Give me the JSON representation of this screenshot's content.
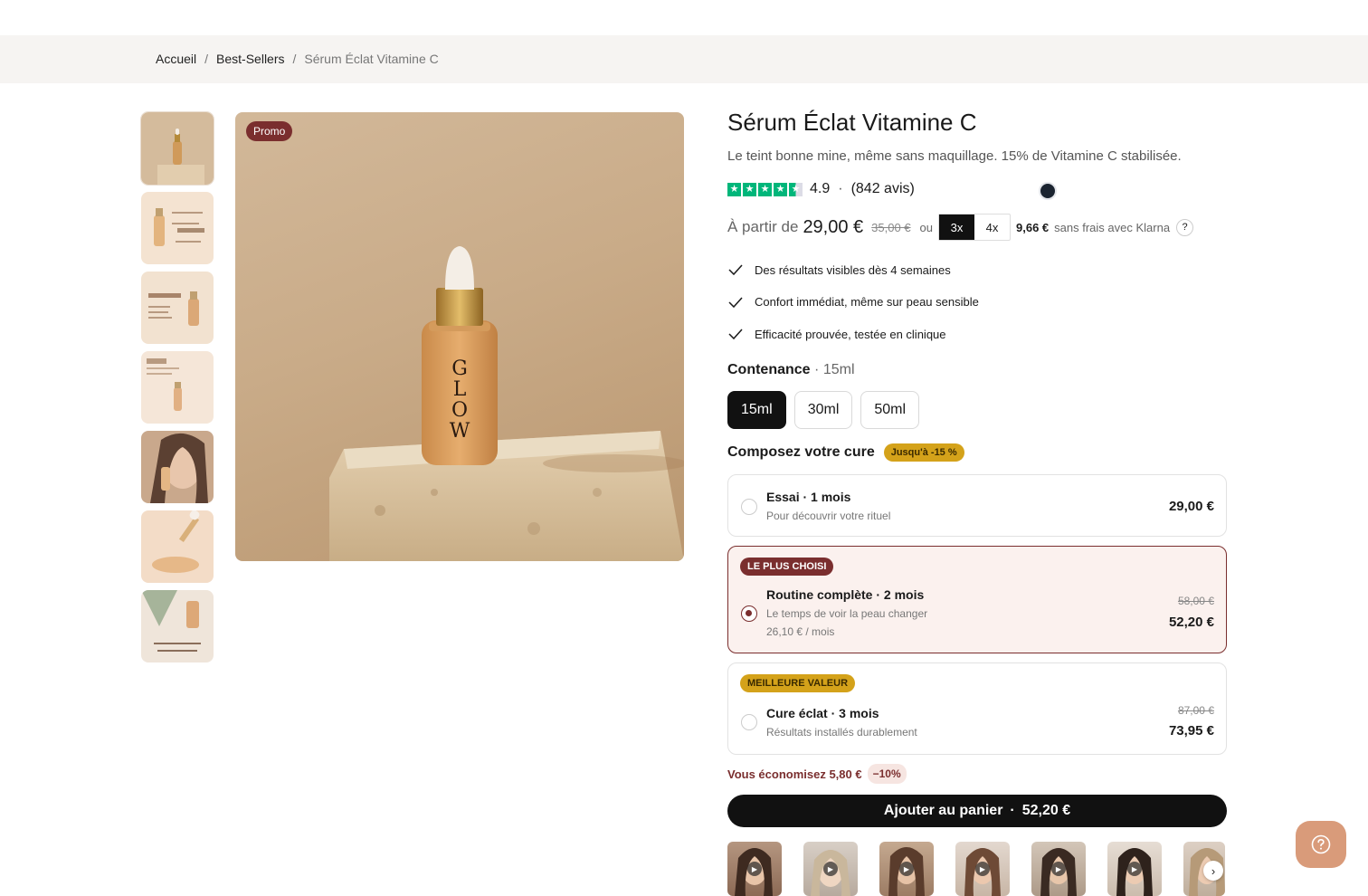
{
  "breadcrumb": {
    "home": "Accueil",
    "category": "Best-Sellers",
    "current": "Sérum Éclat Vitamine C",
    "sep": "/"
  },
  "gallery": {
    "promo_badge": "Promo",
    "bottle_letters": [
      "G",
      "L",
      "O",
      "W"
    ],
    "thumbnails": [
      "product-photo",
      "benefits-card",
      "key-actives-card",
      "stats-card",
      "model-applying",
      "texture-swatch",
      "packaging-card"
    ]
  },
  "product": {
    "title": "Sérum Éclat Vitamine C",
    "subtitle": "Le teint bonne mine, même sans maquillage. 15% de Vitamine C stabilisée.",
    "rating_value": "4.9",
    "rating_sep": "·",
    "rating_count": "(842 avis)",
    "stars": 4.9,
    "star_color": "#00b67a"
  },
  "pricing": {
    "from_label": "À partir de",
    "price": "29,00 €",
    "old_price": "35,00 €",
    "or_label": "ou",
    "installments": [
      "3x",
      "4x"
    ],
    "installment_amount": "9,66 €",
    "klarna_text": "sans frais avec Klarna",
    "help": "?"
  },
  "benefits": [
    "Des résultats visibles dès 4 semaines",
    "Confort immédiat, même sur peau sensible",
    "Efficacité prouvée, testée en clinique"
  ],
  "contenance": {
    "label": "Contenance",
    "sep": "·",
    "selected": "15ml",
    "options": [
      "15ml",
      "30ml",
      "50ml"
    ]
  },
  "cure": {
    "title": "Composez votre cure",
    "badge": "Jusqu'à -15 %",
    "plans": [
      {
        "name": "Essai · 1 mois",
        "desc": "Pour découvrir votre rituel",
        "price": "29,00 €"
      },
      {
        "tag": "LE PLUS CHOISI",
        "name": "Routine complète · 2 mois",
        "desc": "Le temps de voir la peau changer",
        "per_month": "26,10 € / mois",
        "old_price": "58,00 €",
        "price": "52,20 €"
      },
      {
        "tag": "MEILLEURE VALEUR",
        "name": "Cure éclat · 3 mois",
        "desc": "Résultats installés durablement",
        "old_price": "87,00 €",
        "price": "73,95 €"
      }
    ]
  },
  "savings": {
    "text": "Vous économisez 5,80 €",
    "pct": "−10%"
  },
  "cart": {
    "label": "Ajouter au panier",
    "sep": "·",
    "price": "52,20 €"
  },
  "colors": {
    "accent": "#7a2e2e",
    "gold": "#d4a21a",
    "dark": "#111111",
    "help_fab": "#d99b7a"
  }
}
